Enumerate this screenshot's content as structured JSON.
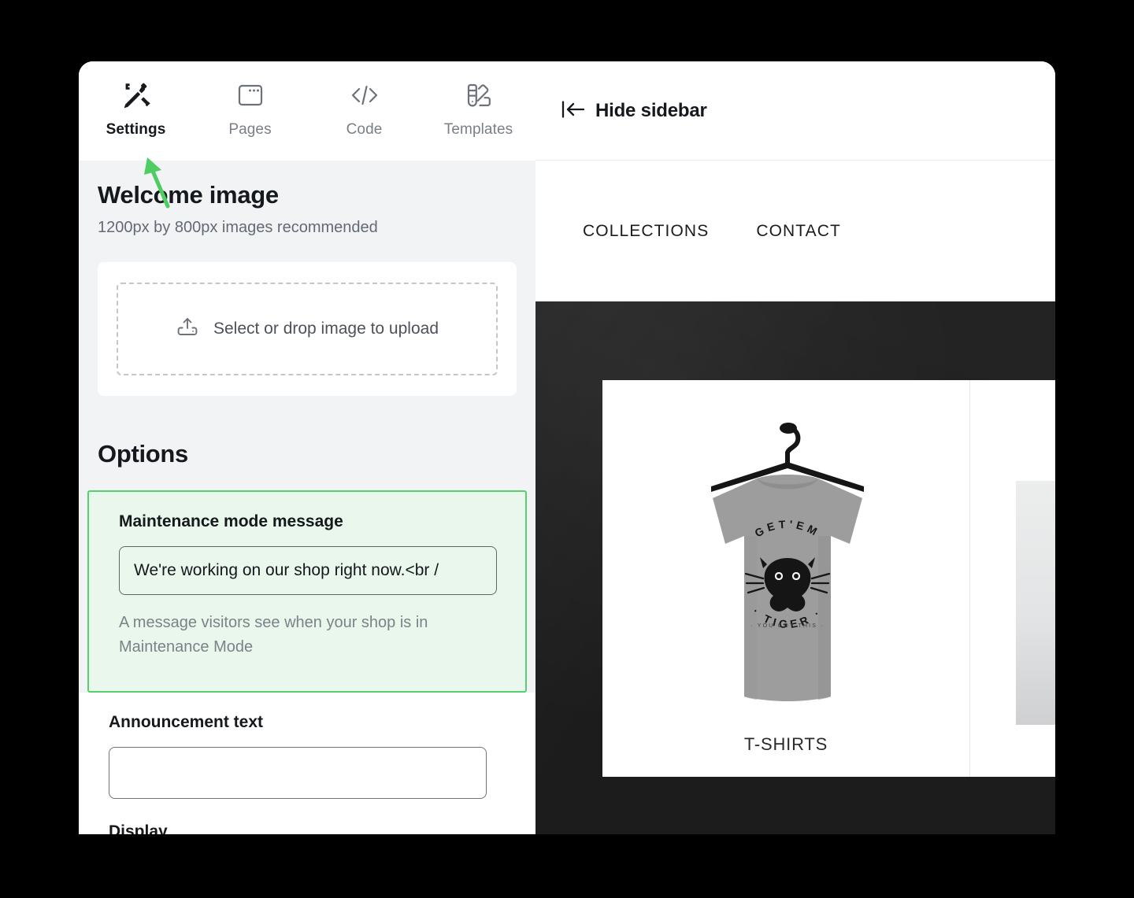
{
  "editor": {
    "tabs": [
      {
        "label": "Settings",
        "icon": "tools-pencil-icon",
        "active": true
      },
      {
        "label": "Pages",
        "icon": "browser-window-icon",
        "active": false
      },
      {
        "label": "Code",
        "icon": "code-brackets-icon",
        "active": false
      },
      {
        "label": "Templates",
        "icon": "color-swatch-icon",
        "active": false
      }
    ]
  },
  "welcome_image": {
    "title": "Welcome image",
    "subtitle": "1200px by 800px images recommended",
    "upload_label": "Select or drop image to upload",
    "upload_icon": "upload-tray-icon"
  },
  "options": {
    "title": "Options",
    "highlighted_field": {
      "label": "Maintenance mode message",
      "value": "We're working on our shop right now.<br /",
      "help": "A message visitors see when your shop is in Maintenance Mode",
      "highlight_border_color": "#54d06f",
      "highlight_background_color": "#e9f7ec"
    },
    "announcement_field": {
      "label": "Announcement text",
      "value": "",
      "placeholder": ""
    },
    "next_field_partial": {
      "label": "Display",
      "value": ""
    }
  },
  "preview": {
    "hide_sidebar_label": "Hide sidebar",
    "hide_sidebar_icon": "collapse-left-icon",
    "site": {
      "nav_links": [
        "COLLECTIONS",
        "CONTACT"
      ],
      "hero_background_color": "#1c1c1c",
      "products": [
        {
          "title": "T-SHIRTS",
          "graphic_top_text": "GET'EM",
          "graphic_bottom_text": "TIGER",
          "graphic_sub_text": "you got this",
          "shirt_color": "#9e9e9e"
        }
      ]
    }
  },
  "annotation": {
    "arrow_color": "#4ecd63",
    "points_to": "Settings"
  }
}
